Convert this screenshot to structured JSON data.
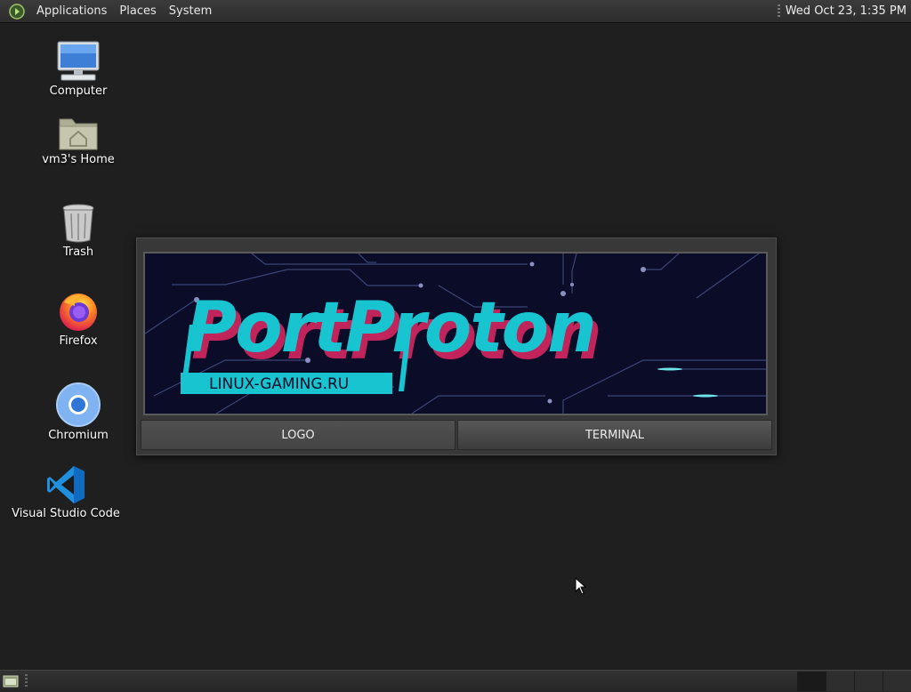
{
  "top_panel": {
    "menus": [
      "Applications",
      "Places",
      "System"
    ],
    "clock": "Wed Oct 23,  1:35 PM"
  },
  "desktop": {
    "icons": [
      {
        "label": "Computer",
        "icon": "computer-icon"
      },
      {
        "label": "vm3's Home",
        "icon": "home-folder-icon"
      },
      {
        "label": "Trash",
        "icon": "trash-icon"
      },
      {
        "label": "Firefox",
        "icon": "firefox-icon"
      },
      {
        "label": "Chromium",
        "icon": "chromium-icon"
      },
      {
        "label": "Visual Studio Code",
        "icon": "vscode-icon"
      }
    ]
  },
  "portproton": {
    "banner_title": "PortProton",
    "banner_subtitle": "LINUX-GAMING.RU",
    "buttons": {
      "logo": "LOGO",
      "terminal": "TERMINAL"
    },
    "colors": {
      "accent": "#18c4cf",
      "shadow": "#c0245a",
      "background": "#0b0c28"
    }
  },
  "bottom_panel": {
    "workspaces": 4
  }
}
